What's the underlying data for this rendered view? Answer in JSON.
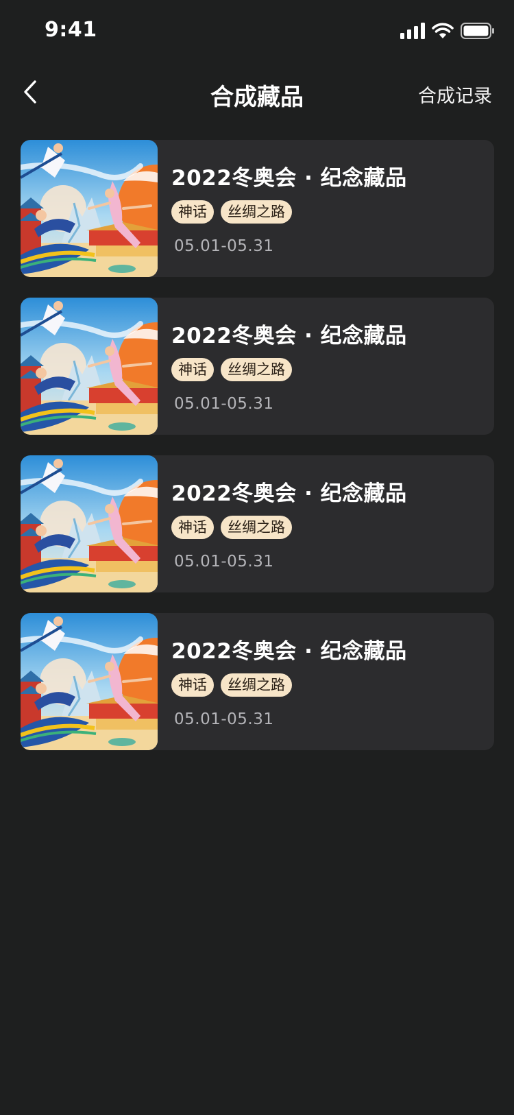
{
  "status_bar": {
    "time": "9:41",
    "icons": [
      "signal-icon",
      "wifi-icon",
      "battery-icon"
    ]
  },
  "nav": {
    "back_icon": "chevron-left-icon",
    "title": "合成藏品",
    "record_label": "合成记录"
  },
  "collection": {
    "items": [
      {
        "title": "2022冬奥会 · 纪念藏品",
        "tags": [
          "神话",
          "丝绸之路"
        ],
        "date": "05.01-05.31"
      },
      {
        "title": "2022冬奥会 · 纪念藏品",
        "tags": [
          "神话",
          "丝绸之路"
        ],
        "date": "05.01-05.31"
      },
      {
        "title": "2022冬奥会 · 纪念藏品",
        "tags": [
          "神话",
          "丝绸之路"
        ],
        "date": "05.01-05.31"
      },
      {
        "title": "2022冬奥会 · 纪念藏品",
        "tags": [
          "神话",
          "丝绸之路"
        ],
        "date": "05.01-05.31"
      }
    ]
  },
  "colors": {
    "background": "#1e1f1f",
    "card": "#2c2c2e",
    "tag_bg": "#f7e5c8",
    "tag_text": "#2a2016",
    "date_text": "#b4b4b8"
  }
}
